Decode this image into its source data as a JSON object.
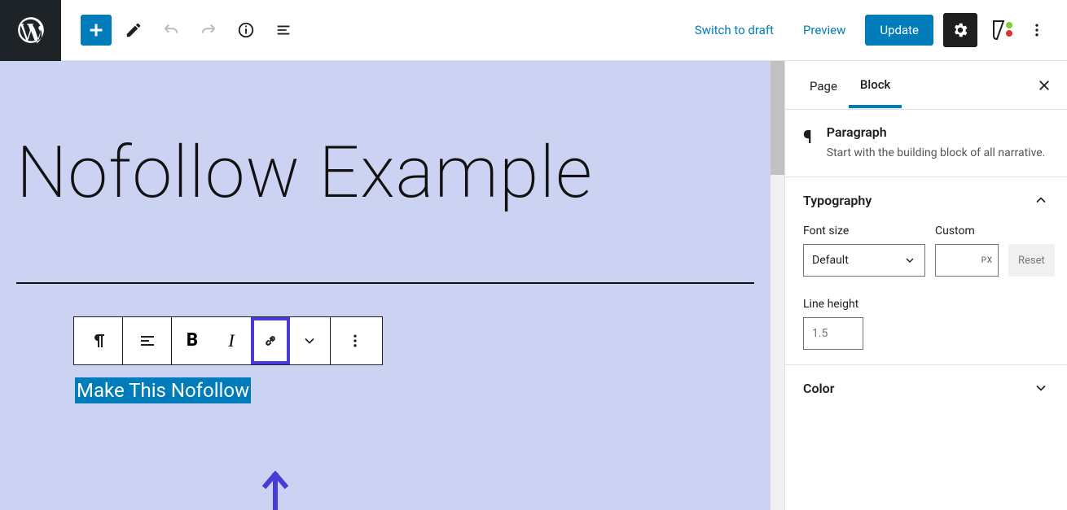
{
  "topbar": {
    "draft_link": "Switch to draft",
    "preview": "Preview",
    "update": "Update"
  },
  "editor": {
    "title": "Nofollow Example",
    "selected_text": "Make This Nofollow"
  },
  "block_toolbar": {
    "icons": {
      "paragraph": "paragraph-icon",
      "align": "align-icon",
      "bold": "bold-icon",
      "italic": "italic-icon",
      "link": "link-icon",
      "chevron": "chevron-down-icon",
      "more": "more-vertical-icon"
    }
  },
  "sidebar": {
    "tabs": {
      "page": "Page",
      "block": "Block"
    },
    "block": {
      "name": "Paragraph",
      "desc": "Start with the building block of all narrative."
    },
    "typography": {
      "title": "Typography",
      "font_size_label": "Font size",
      "font_size_value": "Default",
      "custom_label": "Custom",
      "custom_unit": "PX",
      "reset": "Reset",
      "line_height_label": "Line height",
      "line_height_placeholder": "1.5"
    },
    "color": {
      "title": "Color"
    }
  }
}
